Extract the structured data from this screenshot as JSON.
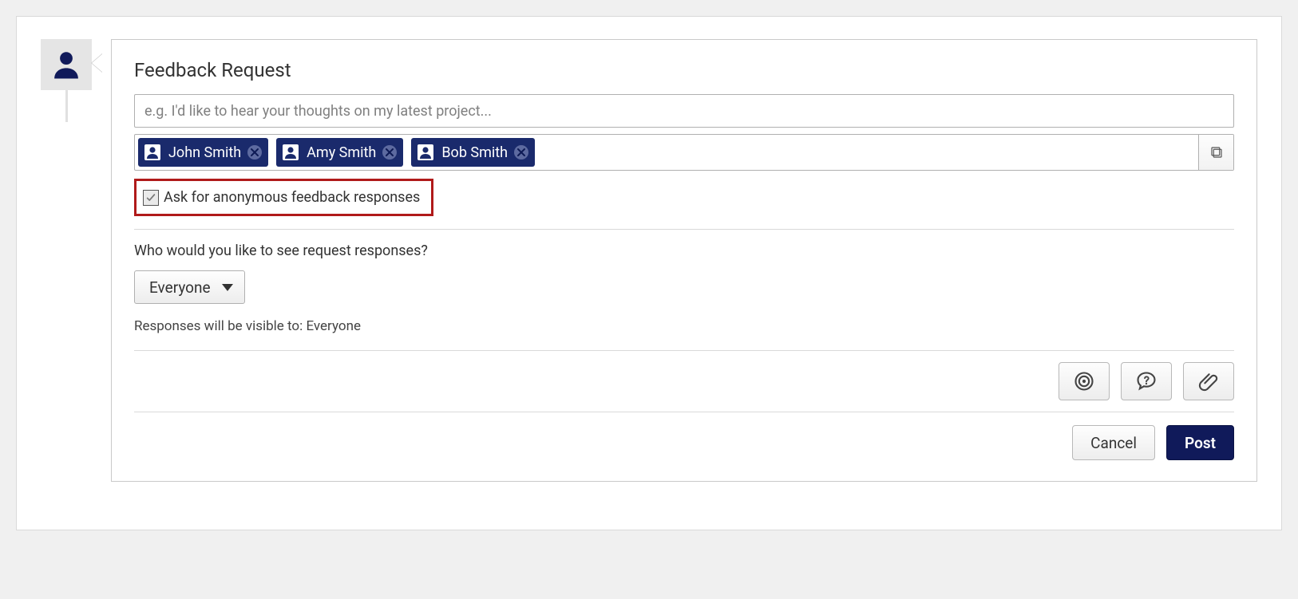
{
  "form": {
    "title": "Feedback Request",
    "message_placeholder": "e.g. I'd like to hear your thoughts on my latest project...",
    "recipients": [
      {
        "name": "John Smith"
      },
      {
        "name": "Amy Smith"
      },
      {
        "name": "Bob Smith"
      }
    ],
    "anonymous_label": "Ask for anonymous feedback responses",
    "anonymous_checked": true,
    "visibility_question": "Who would you like to see request responses?",
    "visibility_selected": "Everyone",
    "visibility_note": "Responses will be visible to: Everyone"
  },
  "buttons": {
    "cancel": "Cancel",
    "post": "Post"
  },
  "icons": {
    "avatar": "person-icon",
    "picker": "people-picker-icon",
    "target": "target-icon",
    "question": "question-bubble-icon",
    "attach": "paperclip-icon"
  },
  "colors": {
    "brand_dark": "#101a5a",
    "chip_bg": "#1a2a6c",
    "highlight_border": "#b01a1a"
  }
}
